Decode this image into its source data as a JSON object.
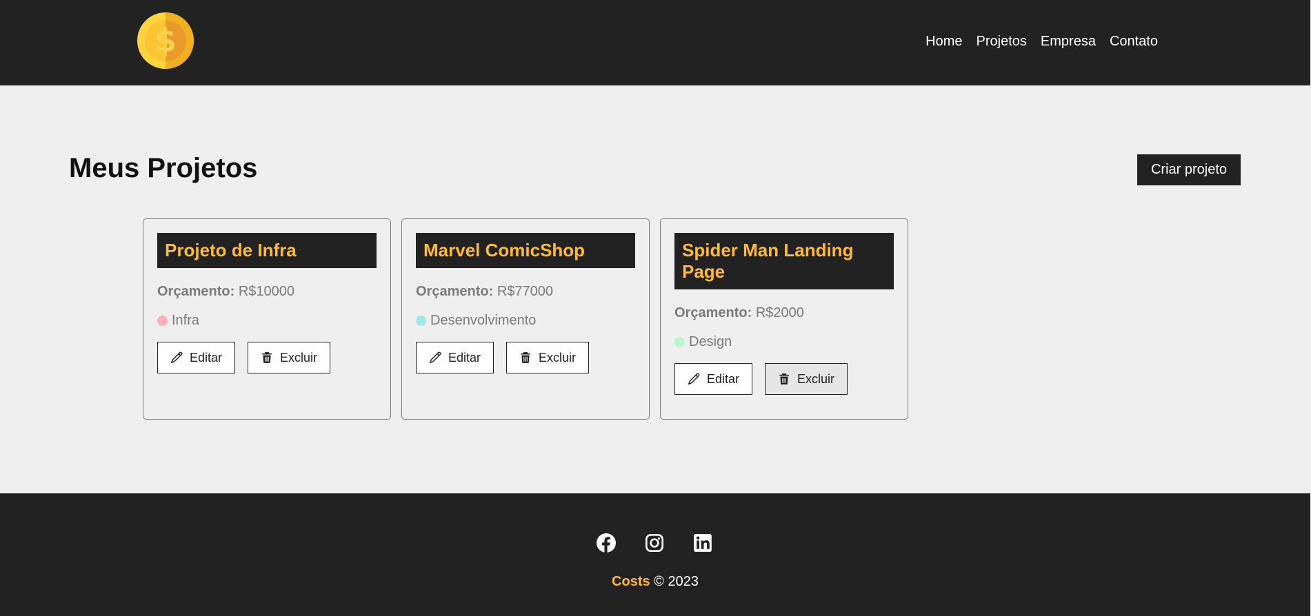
{
  "navbar": {
    "logo_icon": "dollar-coin-icon",
    "links": [
      "Home",
      "Projetos",
      "Empresa",
      "Contato"
    ]
  },
  "main": {
    "title": "Meus Projetos",
    "create_button": "Criar projeto",
    "projects": [
      {
        "name": "Projeto de Infra",
        "budget_label": "Orçamento:",
        "budget_value": "R$10000",
        "category": "Infra",
        "category_color": "#ffaebc",
        "edit_label": "Editar",
        "delete_label": "Excluir"
      },
      {
        "name": "Marvel ComicShop",
        "budget_label": "Orçamento:",
        "budget_value": "R$77000",
        "category": "Desenvolvimento",
        "category_color": "#a0e7e5",
        "edit_label": "Editar",
        "delete_label": "Excluir"
      },
      {
        "name": "Spider Man Landing Page",
        "budget_label": "Orçamento:",
        "budget_value": "R$2000",
        "category": "Design",
        "category_color": "#b4f8c8",
        "edit_label": "Editar",
        "delete_label": "Excluir"
      }
    ]
  },
  "footer": {
    "social_icons": [
      "facebook-icon",
      "instagram-icon",
      "linkedin-icon"
    ],
    "brand": "Costs",
    "copyright": "© 2023"
  },
  "colors": {
    "dark": "#222222",
    "accent": "#ffbb33",
    "background": "#efefef"
  }
}
